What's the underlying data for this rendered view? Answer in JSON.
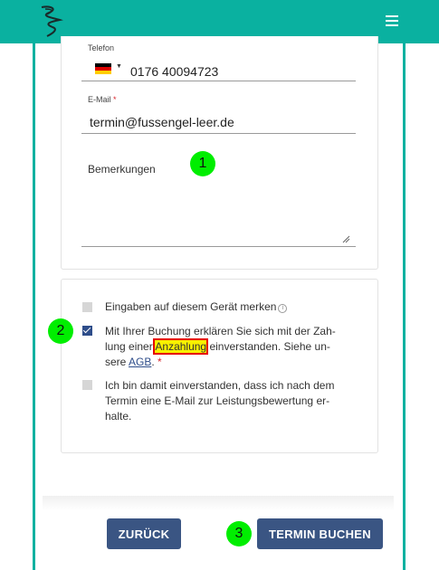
{
  "header": {
    "logo_icon": "swirl-logo-icon",
    "menu_icon": "hamburger-menu-icon",
    "brand_color": "#0ab1a0"
  },
  "form": {
    "phone": {
      "label": "Telefon",
      "country_icon": "germany-flag-icon",
      "value": "0176 40094723"
    },
    "email": {
      "label": "E-Mail",
      "required_marker": "*",
      "value": "termin@fussengel-leer.de"
    },
    "remarks": {
      "label": "Bemerkungen",
      "value": ""
    }
  },
  "consents": {
    "remember": {
      "label": "Eingaben auf diesem Gerät merken",
      "info_icon": "info-icon",
      "checked": false
    },
    "deposit": {
      "text_line1": "Mit Ihrer Buchung erklären Sie sich mit der Zah-",
      "text_before": "lung einer ",
      "highlight": "Anzahlung",
      "text_after": " einverstanden. Siehe un-",
      "text_line3": "sere ",
      "link": "AGB",
      "end": ".",
      "required_marker": "*",
      "checked": true
    },
    "review": {
      "text": "Ich bin damit einverstanden, dass ich nach dem Termin eine E-Mail zur Leistungsbewertung er-halte.",
      "checked": false
    }
  },
  "annotations": [
    "1",
    "2",
    "3"
  ],
  "buttons": {
    "back": "ZURÜCK",
    "book": "TERMIN BUCHEN"
  },
  "colors": {
    "accent": "#0ab1a0",
    "button": "#3a5583",
    "annotation": "#00ee00",
    "highlight": "#f8f000"
  }
}
